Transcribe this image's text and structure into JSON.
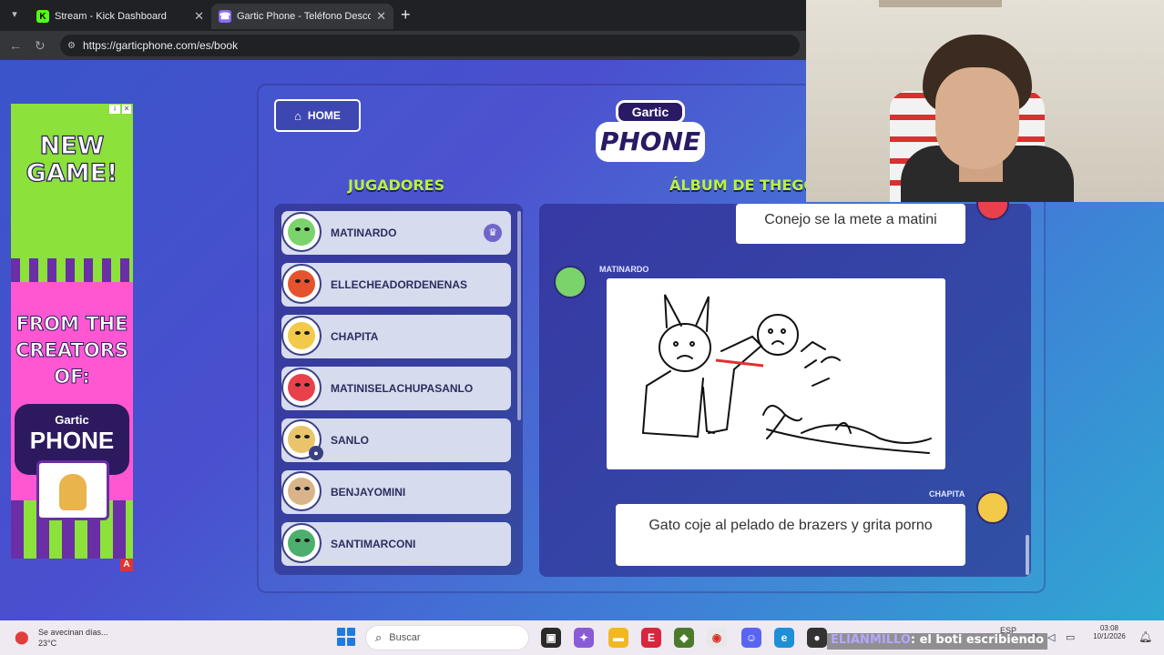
{
  "browser": {
    "tabs": [
      {
        "title": "Stream - Kick Dashboard",
        "active": false
      },
      {
        "title": "Gartic Phone - Teléfono Descompuesto",
        "active": true
      }
    ],
    "url": "https://garticphone.com/es/book"
  },
  "ad": {
    "headline": "NEW GAME!",
    "tagline": "FROM THE CREATORS OF:",
    "logo_top": "Gartic",
    "logo_main": "PHONE"
  },
  "game": {
    "home_label": "HOME",
    "logo_top": "Gartic",
    "logo_main": "PHONE",
    "players_heading": "JUGADORES",
    "album_heading": "ÁLBUM DE THEGO",
    "players": [
      {
        "name": "MATINARDO",
        "color": "#7ad36b",
        "crown": true
      },
      {
        "name": "ELLECHEADORDENENAS",
        "color": "#e4532e",
        "crown": false
      },
      {
        "name": "CHAPITA",
        "color": "#f3c94a",
        "crown": false
      },
      {
        "name": "MATINISELACHUPASANLO",
        "color": "#e8414b",
        "crown": false
      },
      {
        "name": "SANLO",
        "color": "#e9c46a",
        "crown": false
      },
      {
        "name": "BENJAYOMINI",
        "color": "#d9b48a",
        "crown": false
      },
      {
        "name": "SANTIMARCONI",
        "color": "#4caf6e",
        "crown": false
      }
    ],
    "messages": [
      {
        "text": "Conejo se la mete a matini"
      },
      {
        "author": "MATINARDO",
        "type": "drawing"
      },
      {
        "author": "CHAPITA",
        "text": "Gato coje al pelado de brazers y grita porno"
      }
    ]
  },
  "taskbar": {
    "weather_line1": "Se avecinan días...",
    "weather_line2": "23°C",
    "search_placeholder": "Buscar",
    "chat_overlay_name": "ELIANMILLO",
    "chat_overlay_text": ": el boti escribiendo",
    "lang": "ESP",
    "time": "03:08",
    "date": "10/1/2026"
  }
}
